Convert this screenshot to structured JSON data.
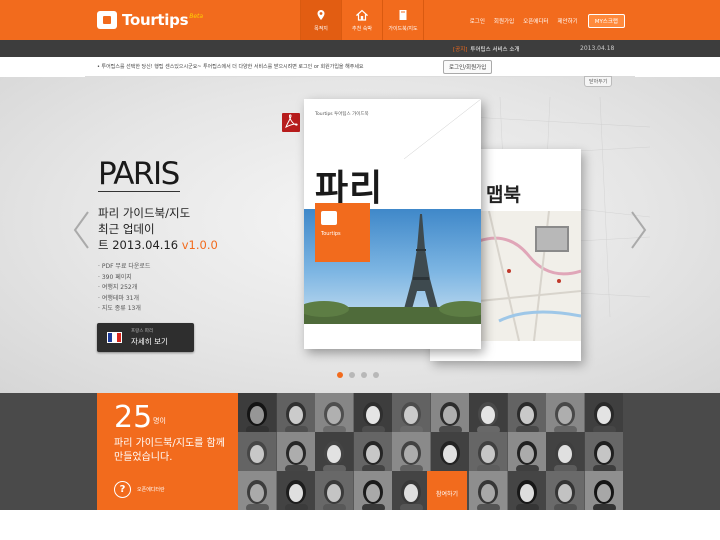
{
  "header": {
    "logo_text": "Tourtips",
    "logo_beta": "Beta",
    "nav": [
      {
        "label": "목적지",
        "icon": "map-pin-icon"
      },
      {
        "label": "추천 숙박",
        "icon": "home-icon"
      },
      {
        "label": "가이드북/지도",
        "icon": "guidebook-icon"
      }
    ],
    "util_links": [
      "로그인",
      "회원가입",
      "오픈에디터",
      "제안하기"
    ],
    "my_button": "MY스크랩"
  },
  "notice": {
    "tag": "[공지]",
    "text": "투어팁스 서비스 소개",
    "date": "2013.04.18"
  },
  "infobar": {
    "text": "• 투어팁스를 선택한 당신! 행팁 센스있으시군요~ 투어팁스에서 더 다양한 서비스를 받으시려면 로그인 or 회원가입을 해주세요",
    "button": "로그인/회원가입",
    "close": "닫아두기"
  },
  "hero": {
    "title": "PARIS",
    "subtitle_line1": "파리 가이드북/지도",
    "subtitle_line2": "최근 업데이",
    "subtitle_line3": "트 2013.04.16",
    "version": "v1.0.0",
    "features": [
      "PDF 무료 다운로드",
      "390 페이지",
      "여행지 252개",
      "여행테마 31개",
      "지도 종류 13개"
    ],
    "detail_small": "프랑스 파리",
    "detail_main": "자세히 보기",
    "book1_label": "Tourtips 투어팁스 가이드북",
    "book1_title": "파리",
    "book1_logo": "Tourtips",
    "book2_title": "맵북",
    "slides_total": 4,
    "slide_active": 1
  },
  "bottom": {
    "count": "25",
    "unit": "명이",
    "text": "파리 가이드북/지도를 함께 만들었습니다.",
    "help_label": "오픈에디터란",
    "join": "참여하기"
  },
  "colors": {
    "accent": "#f26b1d",
    "dark": "#3d3d3d"
  }
}
